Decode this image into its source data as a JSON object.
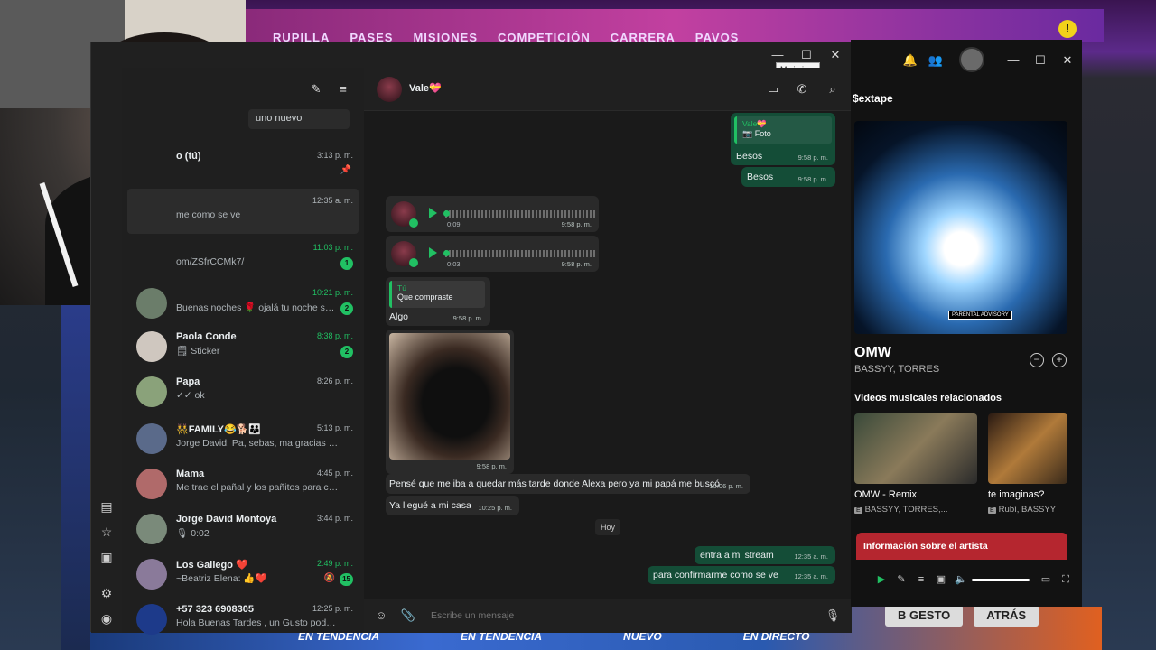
{
  "colors": {
    "accent": "#21c063",
    "outgoing": "#144d37",
    "incoming": "#2a2a2a",
    "spotify_artist_bg": "#b5262f"
  },
  "game": {
    "nav": [
      "RUPILLA",
      "PASES",
      "MISIONES",
      "COMPETICIÓN",
      "CARRERA",
      "PAVOS"
    ],
    "badge": "!",
    "bottom_labels": [
      "EN TENDENCIA",
      "EN TENDENCIA",
      "NUEVO",
      "EN DIRECTO"
    ],
    "keys": [
      "GESTO",
      "ATRÁS"
    ],
    "key_letter": "B"
  },
  "whatsapp": {
    "tooltip": "Minimizar",
    "search_placeholder": "uno nuevo",
    "chats": [
      {
        "name": "o (tú)",
        "message": "",
        "time": "3:13 p. m.",
        "pinned": true
      },
      {
        "name": "",
        "message": "me como se ve",
        "time": "12:35 a. m.",
        "active": true
      },
      {
        "name": "",
        "message": "om/ZSfrCCMk7/",
        "time": "11:03 p. m.",
        "unread": "1"
      },
      {
        "name": "",
        "message": "Buenas noches 🌹 ojalá tu noche sea t...",
        "time": "10:21 p. m.",
        "unread": "2"
      },
      {
        "name": "Paola Conde",
        "message": "🗒 Sticker",
        "time": "8:38 p. m.",
        "unread": "2"
      },
      {
        "name": "Papa",
        "message": "✓✓ ok",
        "time": "8:26 p. m."
      },
      {
        "name": "👯FAMILY😂🐕👪",
        "message": "Jorge David: Pa, sebas, ma gracias 🙏",
        "time": "5:13 p. m."
      },
      {
        "name": "Mama",
        "message": "Me trae el pañal y los pañitos para cam...",
        "time": "4:45 p. m."
      },
      {
        "name": "Jorge David Montoya",
        "message": "🎙 0:02",
        "time": "3:44 p. m."
      },
      {
        "name": "Los Gallego ❤️",
        "message": "~Beatriz Elena: 👍❤️",
        "time": "2:49 p. m.",
        "unread": "15",
        "muted": true
      },
      {
        "name": "+57 323 6908305",
        "message": "Hola Buenas Tardes , un Gusto poder S...",
        "time": "12:25 p. m."
      }
    ],
    "contact": "Vale💝",
    "messages": {
      "quote1_name": "Vale💝",
      "quote1_text": "📷 Foto",
      "m1_text": "Besos",
      "m1_time": "9:58 p. m.",
      "m2_text": "Besos",
      "m2_time": "9:58 p. m.",
      "voice1_dur": "0:09",
      "voice1_time": "9:58 p. m.",
      "voice2_dur": "0:03",
      "voice2_time": "9:58 p. m.",
      "quote2_name": "Tú",
      "quote2_text": "Que compraste",
      "m3_text": "Algo",
      "m3_time": "9:58 p. m.",
      "img_time": "9:58 p. m.",
      "m4_text": "Pensé que me iba a quedar más tarde donde Alexa pero ya mi papá me buscó",
      "m4_time": "10:06 p. m.",
      "m5_text": "Ya llegué a mi casa",
      "m5_time": "10:25 p. m.",
      "day": "Hoy",
      "m6_text": "entra a mi stream",
      "m6_time": "12:35 a. m.",
      "m7_text": "para confirmarme como se ve",
      "m7_time": "12:35 a. m."
    },
    "composer_placeholder": "Escribe un mensaje"
  },
  "spotify": {
    "playlist": "$extape",
    "song": "OMW",
    "artists": "BASSYY, TORRES",
    "related_title": "Videos musicales relacionados",
    "videos": [
      {
        "title": "OMW - Remix",
        "artists": "BASSYY, TORRES,..."
      },
      {
        "title": "te imaginas?",
        "artists": "Rubí, BASSYY"
      }
    ],
    "artist_info": "Información sobre el artista",
    "explicit_label": "PARENTAL ADVISORY",
    "badge": "E"
  }
}
